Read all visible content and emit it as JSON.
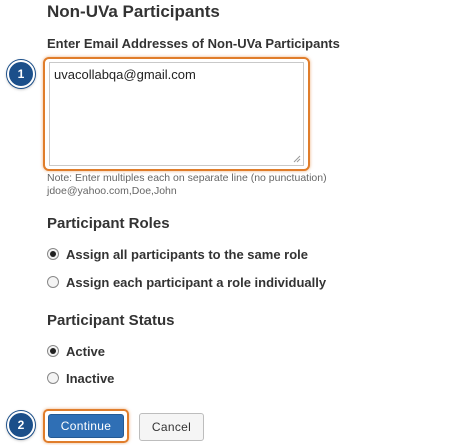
{
  "non_uva": {
    "title": "Non-UVa Participants",
    "field_label": "Enter Email Addresses of Non-UVa Participants",
    "field_value": "uvacollabqa@gmail.com",
    "note_line1": "Note: Enter multiples each on separate line (no punctuation)",
    "note_line2": "jdoe@yahoo.com,Doe,John"
  },
  "roles": {
    "title": "Participant Roles",
    "options": [
      {
        "label": "Assign all participants to the same role",
        "checked": true
      },
      {
        "label": "Assign each participant a role individually",
        "checked": false
      }
    ]
  },
  "status": {
    "title": "Participant Status",
    "options": [
      {
        "label": "Active",
        "checked": true
      },
      {
        "label": "Inactive",
        "checked": false
      }
    ]
  },
  "buttons": {
    "continue": "Continue",
    "cancel": "Cancel"
  },
  "callouts": {
    "step1": "1",
    "step2": "2"
  },
  "colors": {
    "highlight": "#e07d2b",
    "badge": "#1b4f8a",
    "primary_button": "#2f6fb5"
  }
}
